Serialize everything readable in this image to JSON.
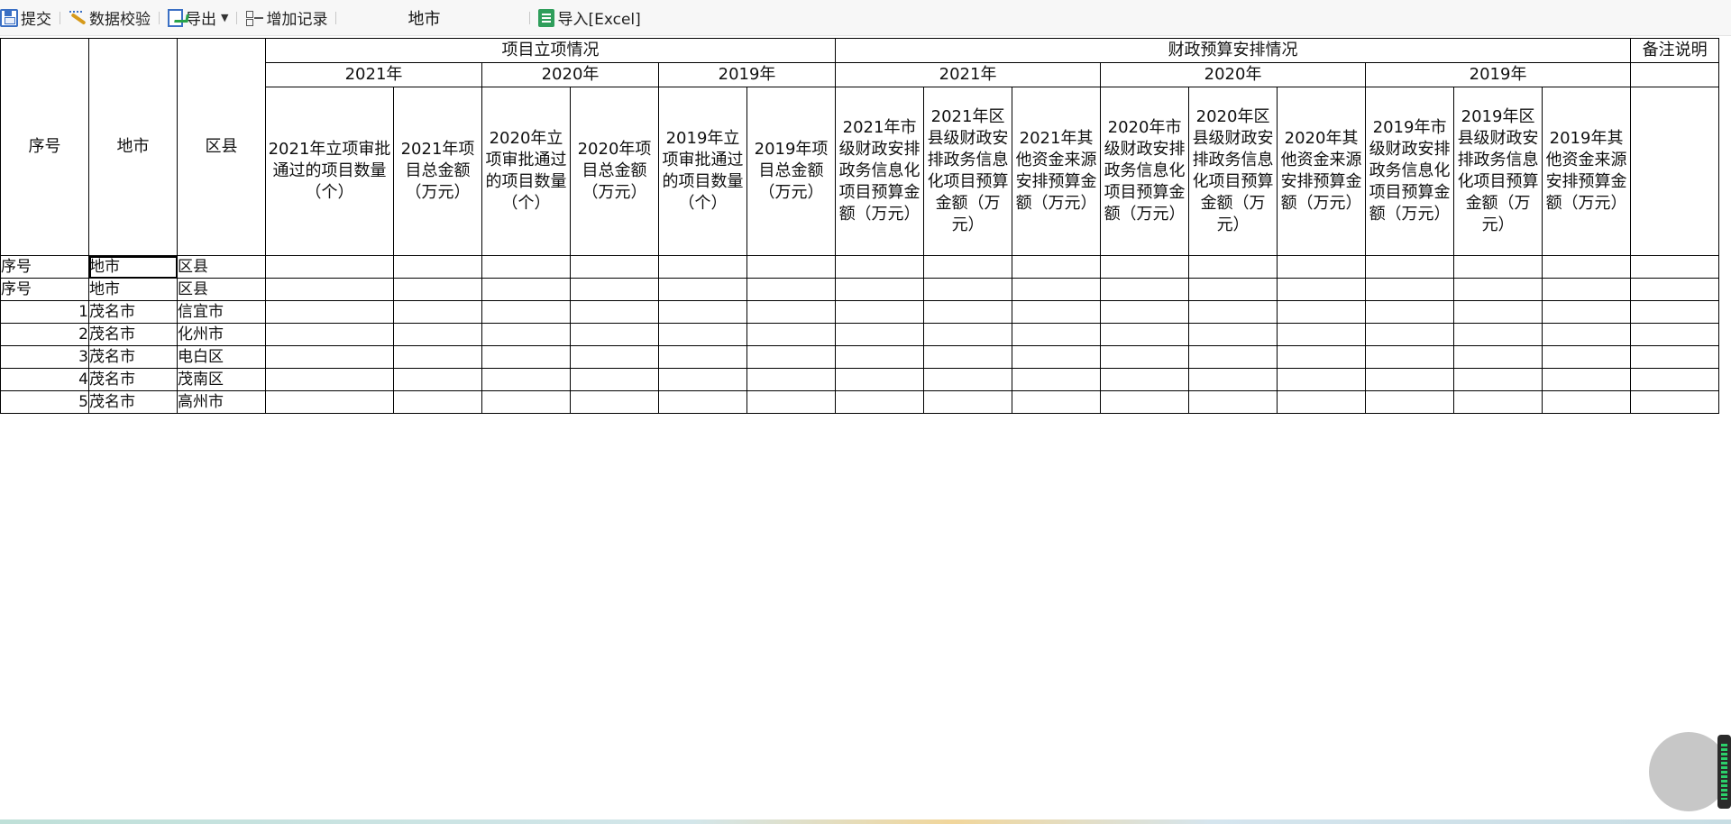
{
  "toolbar": {
    "submit": "提交",
    "validate": "数据校验",
    "export": "导出",
    "add_record": "增加记录",
    "city_label": "地市",
    "import": "导入[Excel]"
  },
  "table": {
    "left_headers": [
      "序号",
      "地市",
      "区县"
    ],
    "group_project": "项目立项情况",
    "group_budget": "财政预算安排情况",
    "group_remark": "备注说明",
    "years": [
      "2021年",
      "2020年",
      "2019年"
    ],
    "project_cols": [
      "2021年立项审批通过的项目数量（个）",
      "2021年项目总金额（万元）",
      "2020年立项审批通过的项目数量（个）",
      "2020年项目总金额（万元）",
      "2019年立项审批通过的项目数量（个）",
      "2019年项目总金额（万元）"
    ],
    "budget_cols": [
      "2021年市级财政安排政务信息化项目预算金额（万元）",
      "2021年区县级财政安排政务信息化项目预算金额（万元）",
      "2021年其他资金来源安排预算金额（万元）",
      "2020年市级财政安排政务信息化项目预算金额（万元）",
      "2020年区县级财政安排政务信息化项目预算金额（万元）",
      "2020年其他资金来源安排预算金额（万元）",
      "2019年市级财政安排政务信息化项目预算金额（万元）",
      "2019年区县级财政安排政务信息化项目预算金额（万元）",
      "2019年其他资金来源安排预算金额（万元）"
    ],
    "rows": [
      {
        "no": "序号",
        "city": "地市",
        "county": "区县"
      },
      {
        "no": "序号",
        "city": "地市",
        "county": "区县"
      },
      {
        "no": "1",
        "city": "茂名市",
        "county": "信宜市"
      },
      {
        "no": "2",
        "city": "茂名市",
        "county": "化州市"
      },
      {
        "no": "3",
        "city": "茂名市",
        "county": "电白区"
      },
      {
        "no": "4",
        "city": "茂名市",
        "county": "茂南区"
      },
      {
        "no": "5",
        "city": "茂名市",
        "county": "高州市"
      }
    ]
  }
}
